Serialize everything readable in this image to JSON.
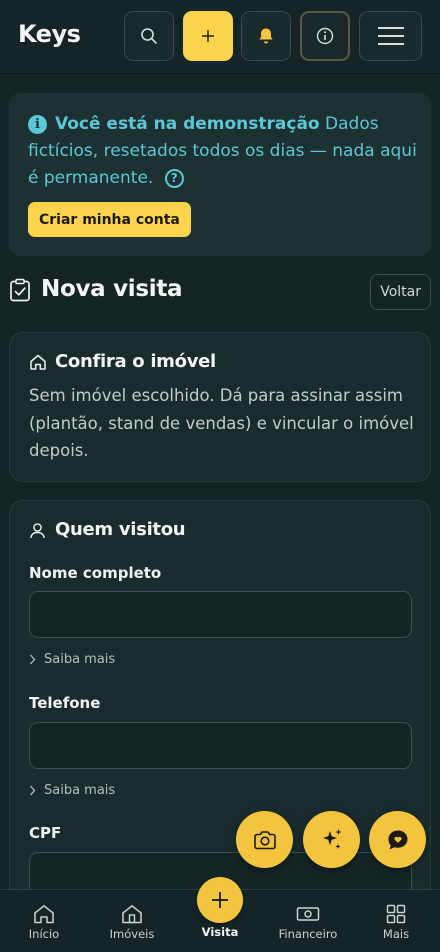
{
  "app": {
    "logo": "Keys"
  },
  "header": {
    "buttons": [
      {
        "icon": "search-icon"
      },
      {
        "icon": "plus-icon"
      },
      {
        "icon": "bell-icon"
      },
      {
        "icon": "info-icon"
      },
      {
        "icon": "menu-icon"
      }
    ]
  },
  "banner": {
    "strong": "Você está na demonstração",
    "text": "Dados fictícios, resetados todos os dias — nada aqui é permanente.",
    "help_glyph": "?",
    "cta_label": "Criar minha conta"
  },
  "page": {
    "title": "Nova visita",
    "back_label": "Voltar"
  },
  "property_card": {
    "title": "Confira o imóvel",
    "body": "Sem imóvel escolhido. Dá para assinar assim (plantão, stand de vendas) e vincular o imóvel depois."
  },
  "visitor_card": {
    "title": "Quem visitou",
    "fields": [
      {
        "label": "Nome completo",
        "value": "",
        "more_label": "Saiba mais"
      },
      {
        "label": "Telefone",
        "value": "",
        "more_label": "Saiba mais"
      },
      {
        "label": "CPF",
        "value": ""
      }
    ]
  },
  "fabs": [
    {
      "icon": "camera-icon"
    },
    {
      "icon": "sparkles-icon"
    },
    {
      "icon": "chat-icon"
    }
  ],
  "bottom_nav": {
    "items": [
      {
        "label": "Início",
        "icon": "home-icon"
      },
      {
        "label": "Imóveis",
        "icon": "building-icon"
      },
      {
        "label": "Visita",
        "icon": "plus-icon"
      },
      {
        "label": "Financeiro",
        "icon": "cash-icon"
      },
      {
        "label": "Mais",
        "icon": "grid-icon"
      }
    ]
  },
  "colors": {
    "background": "#152526",
    "accent": "#fcd34d",
    "info": "#5cc7d6",
    "card": "#192c2d"
  }
}
